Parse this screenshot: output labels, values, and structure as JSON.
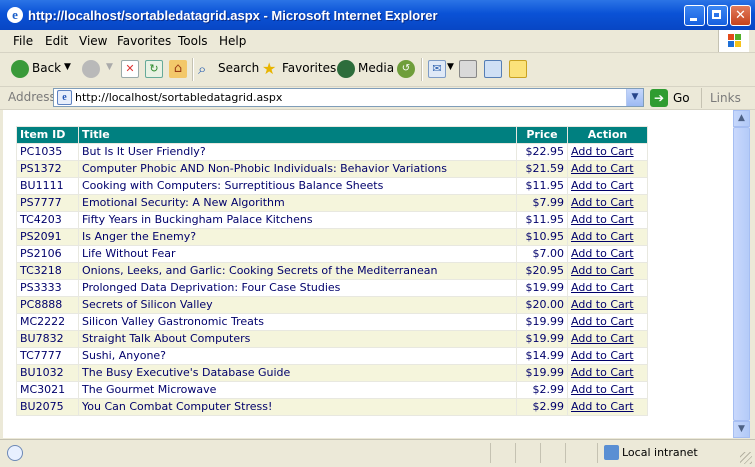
{
  "window": {
    "title": "http://localhost/sortabledatagrid.aspx - Microsoft Internet Explorer"
  },
  "menu": [
    "File",
    "Edit",
    "View",
    "Favorites",
    "Tools",
    "Help"
  ],
  "toolbar": {
    "back": "Back",
    "search": "Search",
    "favorites": "Favorites",
    "media": "Media"
  },
  "address": {
    "label": "Address",
    "url": "http://localhost/sortabledatagrid.aspx",
    "go": "Go",
    "links": "Links"
  },
  "grid": {
    "headers": {
      "id": "Item ID",
      "title": "Title",
      "price": "Price",
      "action": "Action"
    },
    "rows": [
      {
        "id": "PC1035",
        "title": "But Is It User Friendly?",
        "price": "$22.95",
        "action": "Add to Cart"
      },
      {
        "id": "PS1372",
        "title": "Computer Phobic AND Non-Phobic Individuals: Behavior Variations",
        "price": "$21.59",
        "action": "Add to Cart"
      },
      {
        "id": "BU1111",
        "title": "Cooking with Computers: Surreptitious Balance Sheets",
        "price": "$11.95",
        "action": "Add to Cart"
      },
      {
        "id": "PS7777",
        "title": "Emotional Security: A New Algorithm",
        "price": "$7.99",
        "action": "Add to Cart"
      },
      {
        "id": "TC4203",
        "title": "Fifty Years in Buckingham Palace Kitchens",
        "price": "$11.95",
        "action": "Add to Cart"
      },
      {
        "id": "PS2091",
        "title": "Is Anger the Enemy?",
        "price": "$10.95",
        "action": "Add to Cart"
      },
      {
        "id": "PS2106",
        "title": "Life Without Fear",
        "price": "$7.00",
        "action": "Add to Cart"
      },
      {
        "id": "TC3218",
        "title": "Onions, Leeks, and Garlic: Cooking Secrets of the Mediterranean",
        "price": "$20.95",
        "action": "Add to Cart"
      },
      {
        "id": "PS3333",
        "title": "Prolonged Data Deprivation: Four Case Studies",
        "price": "$19.99",
        "action": "Add to Cart"
      },
      {
        "id": "PC8888",
        "title": "Secrets of Silicon Valley",
        "price": "$20.00",
        "action": "Add to Cart"
      },
      {
        "id": "MC2222",
        "title": "Silicon Valley Gastronomic Treats",
        "price": "$19.99",
        "action": "Add to Cart"
      },
      {
        "id": "BU7832",
        "title": "Straight Talk About Computers",
        "price": "$19.99",
        "action": "Add to Cart"
      },
      {
        "id": "TC7777",
        "title": "Sushi, Anyone?",
        "price": "$14.99",
        "action": "Add to Cart"
      },
      {
        "id": "BU1032",
        "title": "The Busy Executive's Database Guide",
        "price": "$19.99",
        "action": "Add to Cart"
      },
      {
        "id": "MC3021",
        "title": "The Gourmet Microwave",
        "price": "$2.99",
        "action": "Add to Cart"
      },
      {
        "id": "BU2075",
        "title": "You Can Combat Computer Stress!",
        "price": "$2.99",
        "action": "Add to Cart"
      }
    ]
  },
  "status": {
    "zone": "Local intranet"
  },
  "colors": {
    "header_bg": "#008080",
    "row_alt_bg": "#f5f5dc",
    "text": "#00006b"
  }
}
